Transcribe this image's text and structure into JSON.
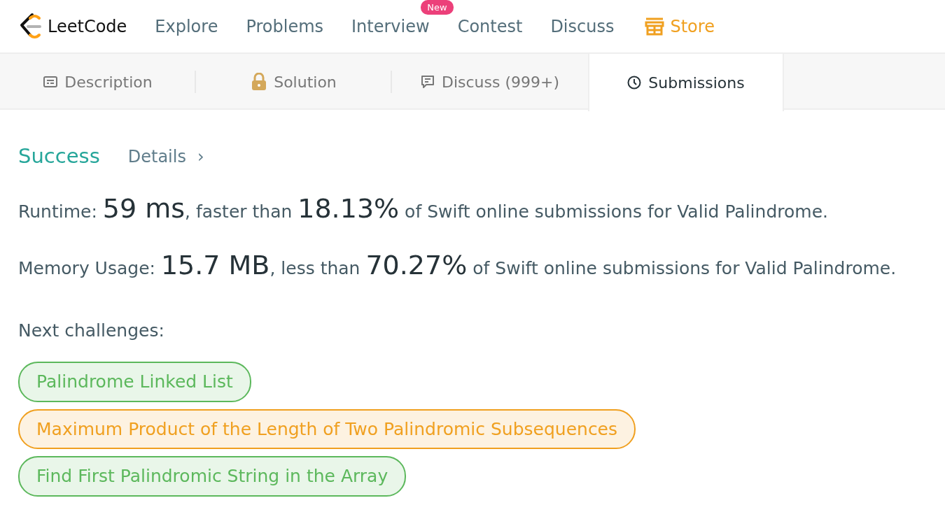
{
  "brand": "LeetCode",
  "nav": [
    {
      "label": "Explore",
      "kind": "link"
    },
    {
      "label": "Problems",
      "kind": "link"
    },
    {
      "label": "Interview",
      "kind": "link",
      "badge": "New"
    },
    {
      "label": "Contest",
      "kind": "link"
    },
    {
      "label": "Discuss",
      "kind": "link"
    },
    {
      "label": "Store",
      "kind": "store"
    }
  ],
  "tabs": [
    {
      "label": "Description",
      "kind": "description",
      "selected": false
    },
    {
      "label": "Solution",
      "kind": "locked",
      "selected": false
    },
    {
      "label": "Discuss (999+)",
      "kind": "discuss",
      "selected": false
    },
    {
      "label": "Submissions",
      "kind": "submissions",
      "selected": true
    }
  ],
  "result": {
    "status": "Success",
    "details": "Details",
    "chevron": "›"
  },
  "stats": [
    {
      "label": "Runtime: ",
      "value": "59 ms",
      "middle": ", faster than ",
      "percent": "18.13%",
      "tail": " of Swift online submissions for Valid Palindrome."
    },
    {
      "label": "Memory Usage: ",
      "value": "15.7 MB",
      "middle": ", less than ",
      "percent": "70.27%",
      "tail": " of Swift online submissions for Valid Palindrome."
    }
  ],
  "next_heading": "Next challenges:",
  "challenges": [
    {
      "title": "Palindrome Linked List",
      "color": "#5cb85c"
    },
    {
      "title": "Maximum Product of the Length of Two Palindromic Subsequences",
      "color": "#f0a020"
    },
    {
      "title": "Find First Palindromic String in the Array",
      "color": "#5cb85c"
    }
  ]
}
